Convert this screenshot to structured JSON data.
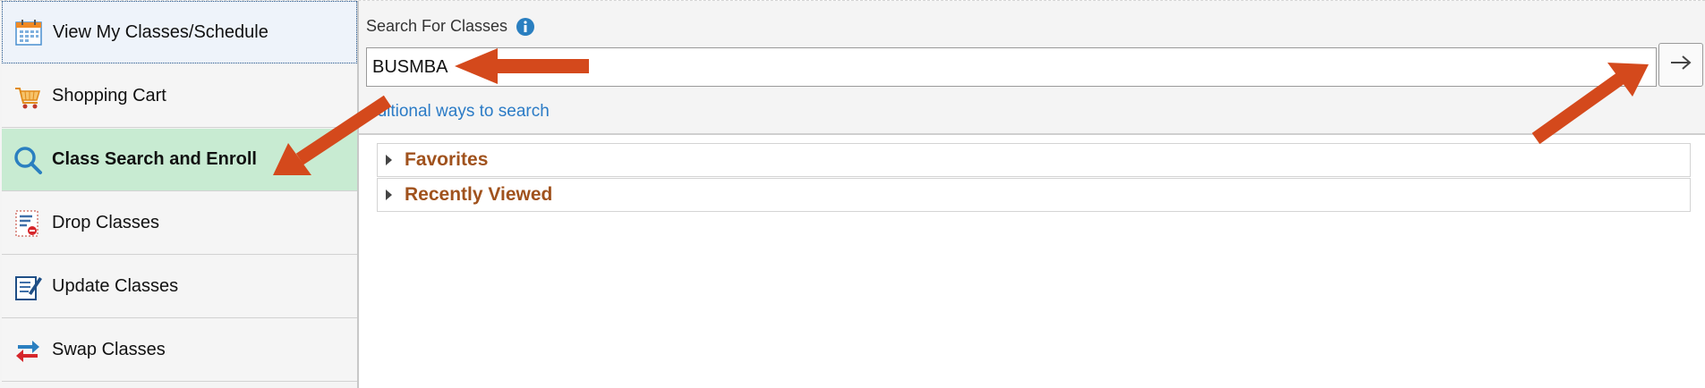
{
  "sidebar": {
    "items": [
      {
        "label": "View My Classes/Schedule",
        "icon": "calendar-icon"
      },
      {
        "label": "Shopping Cart",
        "icon": "shopping-cart-icon"
      },
      {
        "label": "Class Search and Enroll",
        "icon": "search-icon",
        "active": true
      },
      {
        "label": "Drop Classes",
        "icon": "drop-classes-icon"
      },
      {
        "label": "Update Classes",
        "icon": "update-classes-icon"
      },
      {
        "label": "Swap Classes",
        "icon": "swap-arrows-icon"
      }
    ]
  },
  "search": {
    "label": "Search For Classes",
    "info_icon": "info-icon",
    "value": "BUSMBA",
    "go_icon": "arrow-right-icon",
    "more_link": "dditional ways to search"
  },
  "sections": [
    {
      "title": "Favorites",
      "icon": "caret-right-icon"
    },
    {
      "title": "Recently Viewed",
      "icon": "caret-right-icon"
    }
  ],
  "colors": {
    "active_item_bg": "#c8ebd2",
    "section_title": "#a0521d",
    "link": "#2b7bc6",
    "annotation_arrow": "#d4491c"
  }
}
